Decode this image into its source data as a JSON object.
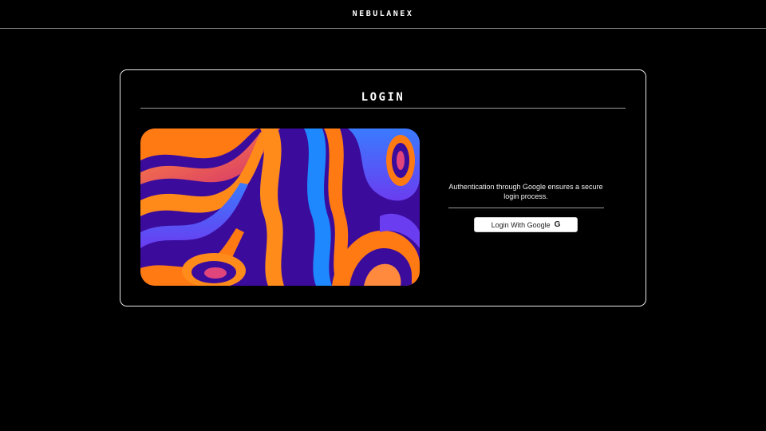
{
  "header": {
    "brand": "NEBULANEX"
  },
  "login_card": {
    "title": "LOGIN",
    "description": "Authentication through Google ensures a secure login process.",
    "google_button_label": "Login With Google",
    "google_icon_glyph": "G"
  },
  "colors": {
    "background": "#000000",
    "card_border": "#e8e8e8",
    "art_purple": "#3a0ca3",
    "art_orange": "#ff7f11",
    "art_blue": "#1e88ff",
    "art_pink": "#e0457b"
  },
  "icons": {
    "google": "google-g-icon"
  }
}
